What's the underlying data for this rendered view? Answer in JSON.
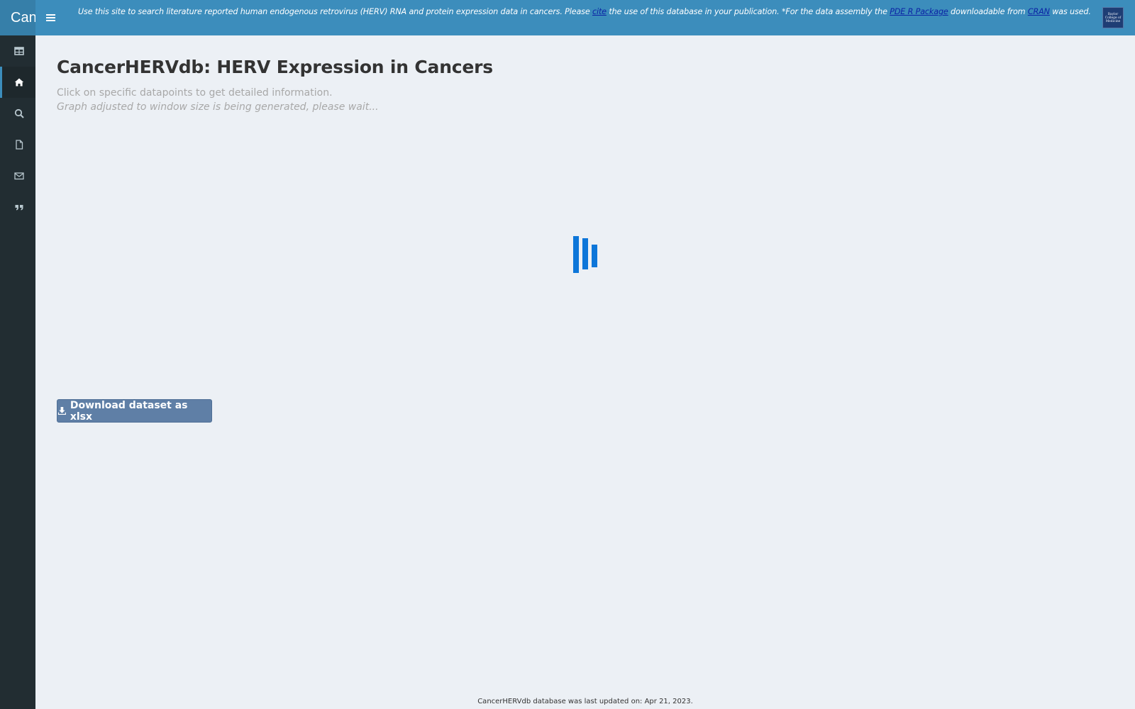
{
  "header": {
    "brand": "CancerHERVdb",
    "banner": {
      "part1": "Use this site to search literature reported human endogenous retrovirus (HERV) RNA and protein expression data in cancers. Please ",
      "cite_link": "cite",
      "part2": " the use of this database in your publication. *For the data assembly the ",
      "package_link": "PDE R Package",
      "part3": " downloadable from ",
      "cran_link": "CRAN",
      "part4": " was used."
    },
    "logo_text": [
      "Baylor",
      "College of",
      "Medicine"
    ]
  },
  "sidebar": {
    "items": [
      {
        "icon": "table-icon",
        "active": false
      },
      {
        "icon": "home-icon",
        "active": true
      },
      {
        "icon": "search-icon",
        "active": false
      },
      {
        "icon": "file-icon",
        "active": false
      },
      {
        "icon": "envelope-icon",
        "active": false
      },
      {
        "icon": "quote-icon",
        "active": false
      }
    ]
  },
  "main": {
    "title": "CancerHERVdb: HERV Expression in Cancers",
    "hint": "Click on specific datapoints to get detailed information.",
    "wait": "Graph adjusted to window size is being generated, please wait...",
    "download_label": "Download dataset as xlsx"
  },
  "footer": {
    "text": "CancerHERVdb database was last updated on: Apr 21, 2023."
  },
  "colors": {
    "header": "#3c8dbc",
    "sidebar": "#222d32",
    "background": "#ecf0f5",
    "spinner": "#0d76d9",
    "button": "#5f7fa6"
  }
}
